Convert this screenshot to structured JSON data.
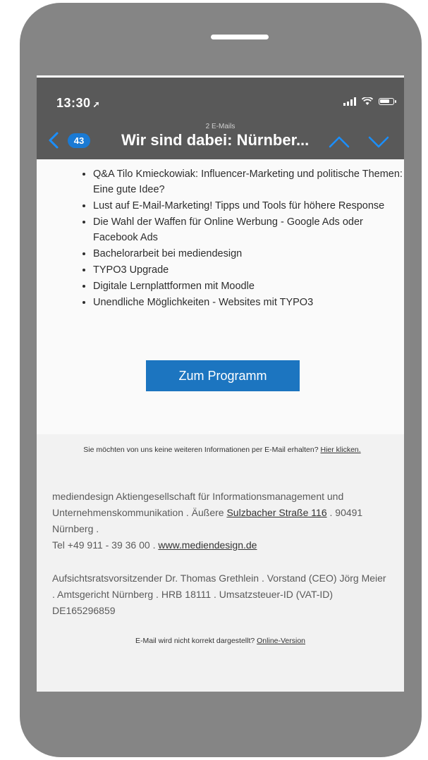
{
  "status": {
    "time": "13:30",
    "location_icon": "location-arrow-icon"
  },
  "header": {
    "subtitle": "2 E-Mails",
    "badge": "43",
    "title": "Wir sind dabei: Nürnber..."
  },
  "bullets": [
    "Q&A Tilo Kmieckowiak: Influencer-Marketing und politische Themen: Eine gute Idee?",
    "Lust auf E-Mail-Marketing! Tipps und Tools für höhere Response",
    "Die Wahl der Waffen für Online Werbung - Google Ads oder Facebook Ads",
    "Bachelorarbeit bei mediendesign",
    "TYPO3 Upgrade",
    "Digitale Lernplattformen mit Moodle",
    "Unendliche Möglichkeiten - Websites mit TYPO3"
  ],
  "cta": {
    "label": "Zum Programm"
  },
  "unsubscribe": {
    "text": "Sie möchten von uns keine weiteren Informationen per E-Mail erhalten?",
    "link": "Hier klicken."
  },
  "company": {
    "line1": "mediendesign Aktiengesellschaft für Informationsmanagement und Unternehmenskommunikation . Äußere",
    "street": "Sulzbacher Straße 116",
    "city": ". 90491 Nürnberg .",
    "tel": "Tel +49 911 - 39 36 00 .",
    "website": "www.mediendesign.de"
  },
  "legal": "Aufsichtsratsvorsitzender Dr. Thomas Grethlein . Vorstand (CEO) Jörg Meier . Amtsgericht Nürnberg . HRB 18111 . Umsatzsteuer-ID (VAT-ID) DE165296859",
  "online": {
    "text": "E-Mail wird nicht korrekt dargestellt?",
    "link": "Online-Version"
  },
  "colors": {
    "phone_frame": "#858585",
    "header_bg": "#595959",
    "accent_blue": "#1c75c0",
    "badge_blue": "#1a7ad4"
  }
}
